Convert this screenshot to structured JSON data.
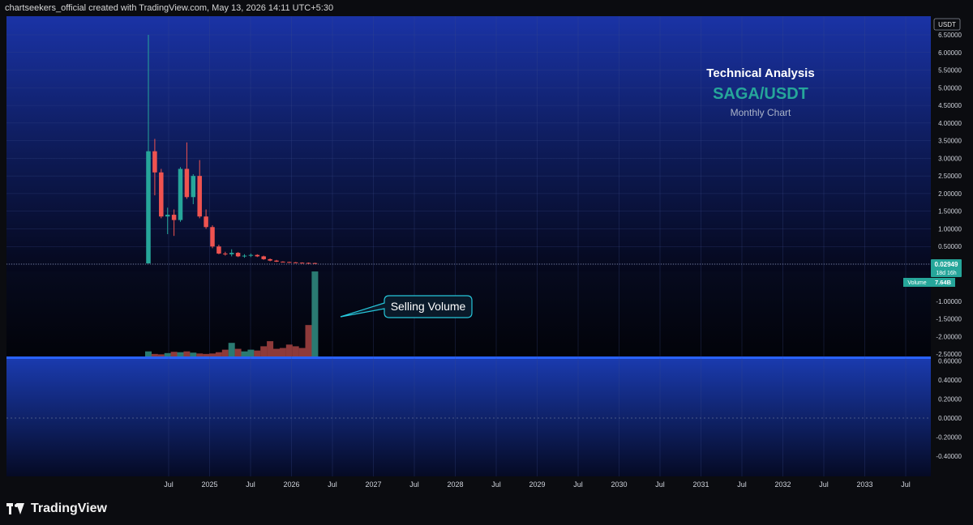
{
  "header": {
    "text": "chartseekers_official created with TradingView.com, May 13, 2026 14:11 UTC+5:30"
  },
  "footer": {
    "brand": "TradingView",
    "logo_icon": "tradingview-logo-icon"
  },
  "chart_data": {
    "type": "candlestick",
    "symbol": "SAGA/USDT",
    "title": "Technical Analysis",
    "subtitle": "SAGA/USDT",
    "caption": "Monthly Chart",
    "currency_label": "USDT",
    "annotation": "Selling Volume",
    "last_price_badge": {
      "price": "0.02949",
      "countdown": "18d 16h"
    },
    "volume_badge": {
      "label": "Volume",
      "value": "7.64B"
    },
    "x_ticks": [
      "Jul",
      "2025",
      "Jul",
      "2026",
      "Jul",
      "2027",
      "Jul",
      "2028",
      "Jul",
      "2029",
      "Jul",
      "2030",
      "Jul",
      "2031",
      "Jul",
      "2032",
      "Jul",
      "2033",
      "Jul"
    ],
    "price_axis_ticks": [
      "6.50000",
      "6.00000",
      "5.50000",
      "5.00000",
      "4.50000",
      "4.00000",
      "3.50000",
      "3.00000",
      "2.50000",
      "2.00000",
      "1.50000",
      "1.00000",
      "0.50000",
      "0.00000",
      "-1.00000",
      "-1.50000",
      "-2.00000",
      "-2.50000"
    ],
    "price_axis_values": [
      6.5,
      6.0,
      5.5,
      5.0,
      4.5,
      4.0,
      3.5,
      3.0,
      2.5,
      2.0,
      1.5,
      1.0,
      0.5,
      0.0,
      -1.0,
      -1.5,
      -2.0,
      -2.5
    ],
    "price_range": [
      0,
      6.5
    ],
    "volume_axis_ticks": [
      "0.60000",
      "0.40000",
      "0.20000",
      "0.00000",
      "-0.20000",
      "-0.40000"
    ],
    "volume_axis_values": [
      0.6,
      0.4,
      0.2,
      0.0,
      -0.2,
      -0.4
    ],
    "grid": true,
    "colors": {
      "up": "#26a69a",
      "down": "#ef5350",
      "vol_up": "#2a7a72",
      "vol_down": "#8e3a3a",
      "panel": "#1c3aa8",
      "line": "#2962ff"
    },
    "candles": [
      {
        "o": 0.02,
        "h": 6.5,
        "l": 0.02,
        "c": 3.2
      },
      {
        "o": 3.2,
        "h": 3.55,
        "l": 1.95,
        "c": 2.6
      },
      {
        "o": 2.6,
        "h": 2.7,
        "l": 1.3,
        "c": 1.35
      },
      {
        "o": 1.35,
        "h": 1.6,
        "l": 0.85,
        "c": 1.4
      },
      {
        "o": 1.4,
        "h": 1.55,
        "l": 0.8,
        "c": 1.25
      },
      {
        "o": 1.25,
        "h": 2.75,
        "l": 1.2,
        "c": 2.7
      },
      {
        "o": 2.7,
        "h": 3.45,
        "l": 1.85,
        "c": 1.9
      },
      {
        "o": 1.9,
        "h": 2.55,
        "l": 1.7,
        "c": 2.5
      },
      {
        "o": 2.5,
        "h": 2.95,
        "l": 1.3,
        "c": 1.35
      },
      {
        "o": 1.35,
        "h": 1.55,
        "l": 1.0,
        "c": 1.05
      },
      {
        "o": 1.05,
        "h": 1.1,
        "l": 0.45,
        "c": 0.5
      },
      {
        "o": 0.5,
        "h": 0.55,
        "l": 0.28,
        "c": 0.3
      },
      {
        "o": 0.3,
        "h": 0.35,
        "l": 0.24,
        "c": 0.28
      },
      {
        "o": 0.28,
        "h": 0.42,
        "l": 0.22,
        "c": 0.32
      },
      {
        "o": 0.32,
        "h": 0.34,
        "l": 0.2,
        "c": 0.22
      },
      {
        "o": 0.22,
        "h": 0.28,
        "l": 0.18,
        "c": 0.24
      },
      {
        "o": 0.24,
        "h": 0.3,
        "l": 0.2,
        "c": 0.26
      },
      {
        "o": 0.26,
        "h": 0.28,
        "l": 0.2,
        "c": 0.22
      },
      {
        "o": 0.22,
        "h": 0.24,
        "l": 0.12,
        "c": 0.14
      },
      {
        "o": 0.14,
        "h": 0.16,
        "l": 0.08,
        "c": 0.1
      },
      {
        "o": 0.1,
        "h": 0.12,
        "l": 0.06,
        "c": 0.07
      },
      {
        "o": 0.07,
        "h": 0.08,
        "l": 0.05,
        "c": 0.06
      },
      {
        "o": 0.06,
        "h": 0.07,
        "l": 0.04,
        "c": 0.05
      },
      {
        "o": 0.05,
        "h": 0.06,
        "l": 0.03,
        "c": 0.04
      },
      {
        "o": 0.04,
        "h": 0.05,
        "l": 0.03,
        "c": 0.035
      },
      {
        "o": 0.035,
        "h": 0.045,
        "l": 0.025,
        "c": 0.03
      },
      {
        "o": 0.03,
        "h": 0.04,
        "l": 0.026,
        "c": 0.0295
      }
    ],
    "volumes": [
      0.6,
      0.3,
      0.25,
      0.4,
      0.55,
      0.5,
      0.6,
      0.45,
      0.35,
      0.3,
      0.35,
      0.5,
      0.8,
      1.6,
      0.9,
      0.6,
      0.8,
      0.7,
      1.2,
      1.8,
      0.9,
      1.0,
      1.4,
      1.2,
      1.0,
      3.7,
      10.0
    ]
  }
}
